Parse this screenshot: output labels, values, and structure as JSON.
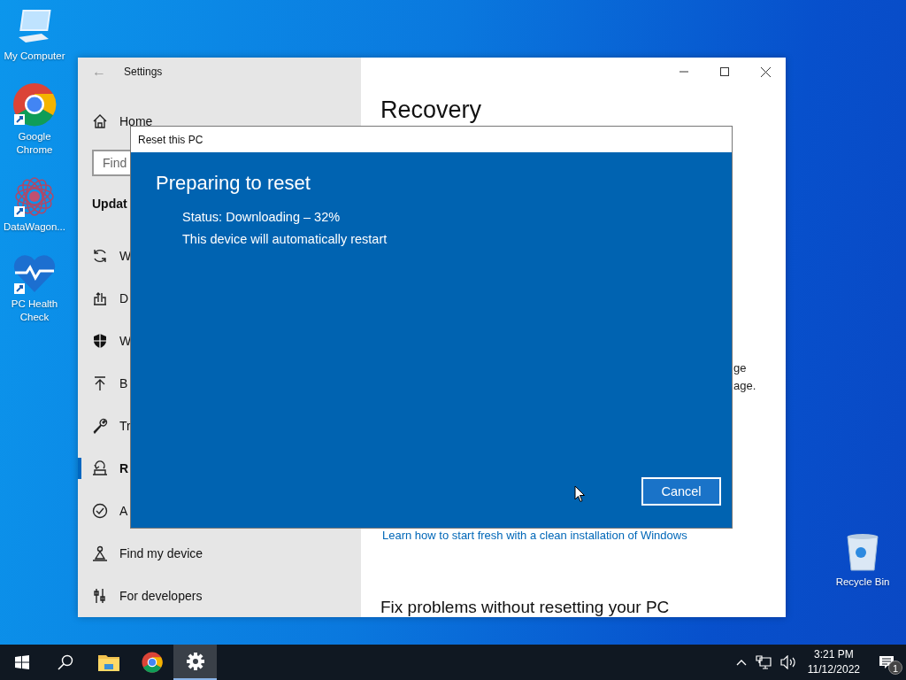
{
  "desktop_icons": [
    {
      "label": "My Computer",
      "kind": "computer"
    },
    {
      "label": "Google Chrome",
      "kind": "chrome"
    },
    {
      "label": "DataWagon...",
      "kind": "mandala"
    },
    {
      "label": "PC Health Check",
      "kind": "health"
    }
  ],
  "recycle_bin": {
    "label": "Recycle Bin"
  },
  "settings_window": {
    "back": "←",
    "title": "Settings",
    "sidebar": {
      "home": "Home",
      "search": {
        "placeholder": "Find"
      },
      "section": "Updat",
      "items": [
        {
          "label": "W",
          "kind": "sync",
          "selected": false
        },
        {
          "label": "D",
          "kind": "delivery",
          "selected": false
        },
        {
          "label": "W",
          "kind": "shield",
          "selected": false
        },
        {
          "label": "B",
          "kind": "backup",
          "selected": false
        },
        {
          "label": "Tr",
          "kind": "wrench",
          "selected": false
        },
        {
          "label": "R",
          "kind": "recovery",
          "selected": true
        },
        {
          "label": "A",
          "kind": "check",
          "selected": false
        },
        {
          "label": "Find my device",
          "kind": "find",
          "selected": false
        },
        {
          "label": "For developers",
          "kind": "developers",
          "selected": false
        }
      ]
    },
    "content": {
      "title": "Recovery",
      "fragments": [
        "ge",
        "age."
      ],
      "link": "Learn how to start fresh with a clean installation of Windows",
      "subheading": "Fix problems without resetting your PC"
    }
  },
  "dialog": {
    "title": "Reset this PC",
    "heading": "Preparing to reset",
    "lines": [
      "Status: Downloading – 32%",
      "This device will automatically restart"
    ],
    "buttons": [
      "Cancel"
    ]
  },
  "taskbar": {
    "apps": [
      {
        "kind": "start",
        "active": false
      },
      {
        "kind": "search",
        "active": false
      },
      {
        "kind": "explorer",
        "active": false
      },
      {
        "kind": "chrome",
        "active": false
      },
      {
        "kind": "settings",
        "active": true
      }
    ],
    "clock": {
      "time": "3:21 PM",
      "date": "11/12/2022"
    },
    "notifications": {
      "badge": "1"
    }
  }
}
